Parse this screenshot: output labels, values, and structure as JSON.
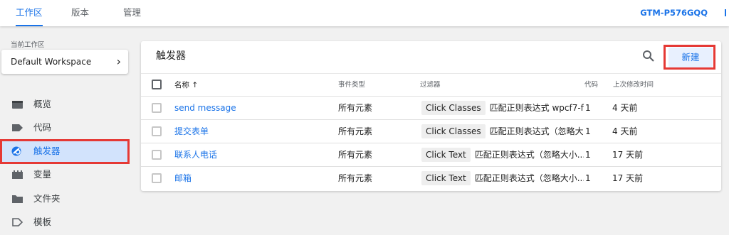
{
  "topbar": {
    "tabs": [
      {
        "label": "工作区",
        "active": true
      },
      {
        "label": "版本",
        "active": false
      },
      {
        "label": "管理",
        "active": false
      }
    ],
    "container_id": "GTM-P576GQQ"
  },
  "sidebar": {
    "workspace_caption": "当前工作区",
    "workspace_name": "Default Workspace",
    "items": [
      {
        "label": "概览",
        "icon": "overview-icon"
      },
      {
        "label": "代码",
        "icon": "tag-icon"
      },
      {
        "label": "触发器",
        "icon": "trigger-icon",
        "selected": true
      },
      {
        "label": "变量",
        "icon": "variable-icon"
      },
      {
        "label": "文件夹",
        "icon": "folder-icon"
      },
      {
        "label": "模板",
        "icon": "template-icon"
      }
    ]
  },
  "main": {
    "title": "触发器",
    "new_button": "新建",
    "columns": {
      "name": "名称 ↑",
      "event_type": "事件类型",
      "filter": "过滤器",
      "tags": "代码",
      "last_edited": "上次修改时间"
    },
    "rows": [
      {
        "name": "send message",
        "event_type": "所有元素",
        "filter_var": "Click Classes",
        "filter_text": "匹配正则表达式 wpcf7-f...",
        "tags": "1",
        "last_edited": "4 天前"
      },
      {
        "name": "提交表单",
        "event_type": "所有元素",
        "filter_var": "Click Classes",
        "filter_text": "匹配正则表达式（忽略大...",
        "tags": "1",
        "last_edited": "4 天前"
      },
      {
        "name": "联系人电话",
        "event_type": "所有元素",
        "filter_var": "Click Text",
        "filter_text": "匹配正则表达式（忽略大小...",
        "tags": "1",
        "last_edited": "17 天前"
      },
      {
        "name": "邮箱",
        "event_type": "所有元素",
        "filter_var": "Click Text",
        "filter_text": "匹配正则表达式（忽略大小...",
        "tags": "1",
        "last_edited": "17 天前"
      }
    ]
  },
  "colors": {
    "accent": "#1a73e8",
    "highlight": "#e53935",
    "selected_bg": "#d2e3fc"
  }
}
